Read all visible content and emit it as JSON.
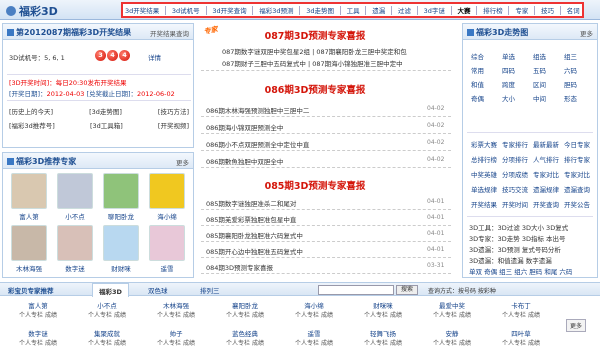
{
  "logo": "福彩3D",
  "topnav": [
    {
      "label": "3d开奖结果",
      "bold": false
    },
    {
      "label": "3d试机号",
      "bold": false
    },
    {
      "label": "3d开奖查询",
      "bold": false
    },
    {
      "label": "福彩3d预测",
      "bold": false
    },
    {
      "label": "3d走势图",
      "bold": false
    },
    {
      "label": "工具",
      "bold": false
    },
    {
      "label": "遗漏",
      "bold": false
    },
    {
      "label": "过滤",
      "bold": false
    },
    {
      "label": "3d字谜",
      "bold": false
    },
    {
      "label": "大赛",
      "bold": true
    },
    {
      "label": "排行榜",
      "bold": false
    },
    {
      "label": "专家",
      "bold": false
    },
    {
      "label": "技巧",
      "bold": false
    },
    {
      "label": "名词",
      "bold": false
    }
  ],
  "result": {
    "title": "第2012087期福彩3D开奖结果",
    "more": "开奖结果查询",
    "trial_label": "3D试机号：",
    "trial": "5, 6, 1",
    "balls": [
      "3",
      "4",
      "4"
    ],
    "detail": "详情",
    "time_label": "[3D开奖时间]：",
    "time": "每日20:30发布开奖结果",
    "open_label": "[开奖日期]：",
    "open_date": "2012-04-03",
    "deadline_label": "[兑奖截止日期]：",
    "deadline": "2012-06-02",
    "links": [
      [
        "[历史上的今天]",
        "[3d走势图]",
        "[技巧方法]"
      ],
      [
        "[福彩3d推荐号]",
        "[3d工具箱]",
        "[开奖视频]"
      ]
    ]
  },
  "experts": {
    "title": "福彩3D推荐专家",
    "more": "更多",
    "items": [
      "富人第",
      "小不点",
      "聊阳卧龙",
      "海小绵",
      "木林海强",
      "数字迷",
      "财财咪",
      "遥雪"
    ]
  },
  "news": {
    "stamp": "专家",
    "sec1_title": "087期3D预测专家喜报",
    "sec1_lines": [
      "087期数字谜双胆中奖包星2组 | 087期襄阳卧龙三胆中奖定和包",
      "087期财子三胆中五码复式中 | 087期海小锦独胆准三胆中定中"
    ],
    "sec2_title": "086期3D预测专家喜报",
    "sec2": [
      {
        "t": "086期木林海强预测独胆中三胆中二",
        "d": "04-02"
      },
      {
        "t": "086期海小锦双胆预测全中",
        "d": "04-02"
      },
      {
        "t": "086期小不点双胆预测全中定位中直",
        "d": "04-02"
      },
      {
        "t": "086期數魚独胆中双胆全中",
        "d": "04-02"
      }
    ],
    "sec3_title": "085期3D预测专家喜报",
    "sec3": [
      {
        "t": "085期数字谜独胆准杀二和尾对",
        "d": "04-01"
      },
      {
        "t": "085期羌爱彩票独胆准包星中直",
        "d": "04-01"
      },
      {
        "t": "085期襄阳卧龙独胆准六码复式中",
        "d": "04-01"
      },
      {
        "t": "085期开心边中独胆准五码复式中",
        "d": "04-01"
      },
      {
        "t": "084期3D预测专家喜报",
        "d": "03-31"
      }
    ]
  },
  "trend": {
    "title": "福彩3D走势图",
    "more": "更多",
    "grid": [
      [
        "综合",
        "单选",
        "组选",
        "组三"
      ],
      [
        "常用",
        "四码",
        "五码",
        "六码"
      ],
      [
        "和值",
        "跨度",
        "区间",
        "胆码"
      ],
      [
        "奇偶",
        "大小",
        "中间",
        "形态"
      ]
    ],
    "grid2": [
      [
        "彩票大赛",
        "专家排行",
        "最新最新",
        "今日专家"
      ],
      [
        "总排行榜",
        "分项排行",
        "人气排行",
        "排行专家"
      ],
      [
        "中奖英雄",
        "分项成绩",
        "专家对比",
        "专家对比"
      ],
      [
        "单选规律",
        "技巧交流",
        "遗漏规律",
        "遗漏查询"
      ],
      [
        "开奖结果",
        "开奖时间",
        "开奖查询",
        "开奖公告"
      ]
    ],
    "tools": [
      "3D工具：3D过滤 3D大小 3D复式",
      "3D专家：3D走势 3D指标 本出号",
      "3D遗漏：3D预测 复式号码分析",
      "3D遗漏：和值遗漏 数字遗漏",
      "单双 奇偶 组三 组六 胆码 和尾 六码"
    ]
  },
  "bottom": {
    "tabs": [
      "彩宝贝专家推荐",
      "福彩3D",
      "双色球",
      "排列三"
    ],
    "search_btn": "搜索",
    "search_text": "查询方式：按号码 按彩种",
    "more": "更多",
    "row1": [
      {
        "n": "富人第",
        "s": "个人专栏 成绩"
      },
      {
        "n": "小不点",
        "s": "个人专栏 成绩"
      },
      {
        "n": "木林海强",
        "s": "个人专栏 成绩"
      },
      {
        "n": "襄阳卧龙",
        "s": "个人专栏 成绩"
      },
      {
        "n": "海小绵",
        "s": "个人专栏 成绩"
      },
      {
        "n": "财咪咪",
        "s": "个人专栏 成绩"
      },
      {
        "n": "最爱中奖",
        "s": "个人专栏 成绩"
      },
      {
        "n": "卡布丁",
        "s": "个人专栏 成绩"
      }
    ],
    "row2": [
      {
        "n": "数字谜",
        "s": "个人专栏 成绩"
      },
      {
        "n": "集聚成就",
        "s": "个人专栏 成绩"
      },
      {
        "n": "帅子",
        "s": "个人专栏 成绩"
      },
      {
        "n": "蓝色经典",
        "s": "个人专栏 成绩"
      },
      {
        "n": "遥雪",
        "s": "个人专栏 成绩"
      },
      {
        "n": "轻舞飞扬",
        "s": "个人专栏 成绩"
      },
      {
        "n": "安静",
        "s": "个人专栏 成绩"
      },
      {
        "n": "四叶草",
        "s": "个人专栏 成绩"
      }
    ]
  }
}
